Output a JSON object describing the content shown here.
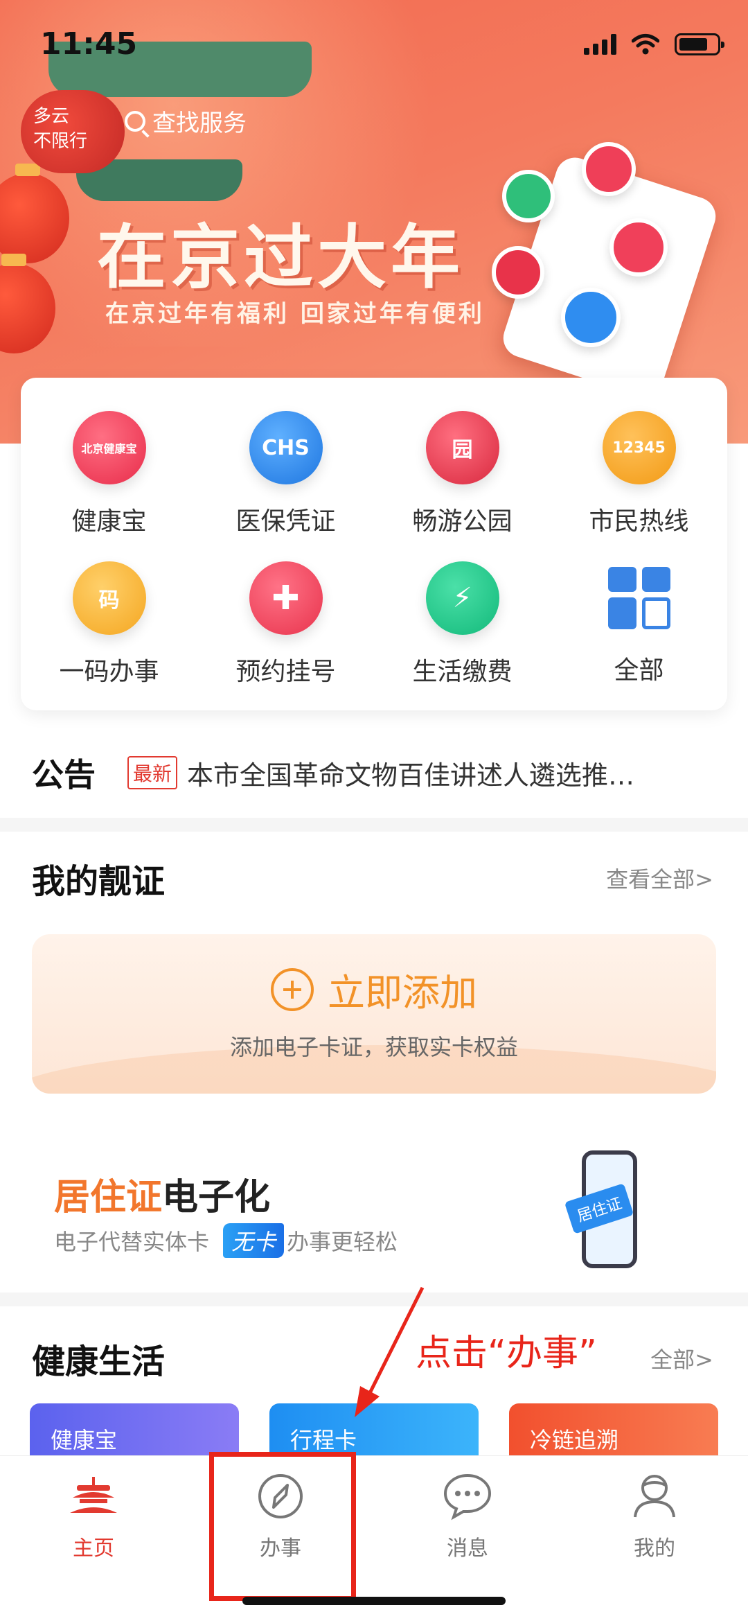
{
  "status_bar": {
    "time": "11:45"
  },
  "header": {
    "weather_line1": "多云",
    "weather_line2": "不限行",
    "search_placeholder": "查找服务"
  },
  "banner": {
    "title": "在京过大年",
    "subtitle": "在京过年有福利  回家过年有便利"
  },
  "services": [
    {
      "label": "健康宝",
      "icon": "temple-health-icon",
      "color": "#f0405a",
      "glyph": "北京健康宝"
    },
    {
      "label": "医保凭证",
      "icon": "chs-insurance-icon",
      "color": "#2f8df0",
      "glyph": "CHS"
    },
    {
      "label": "畅游公园",
      "icon": "park-gate-icon",
      "color": "#e8334a",
      "glyph": "园"
    },
    {
      "label": "市民热线",
      "icon": "headset-hotline-icon",
      "color": "#f5a623",
      "glyph": "12345"
    },
    {
      "label": "一码办事",
      "icon": "briefcase-icon",
      "color": "#f7b531",
      "glyph": "码"
    },
    {
      "label": "预约挂号",
      "icon": "medical-cross-icon",
      "color": "#f0445a",
      "glyph": "✚"
    },
    {
      "label": "生活缴费",
      "icon": "lightning-drop-icon",
      "color": "#1fc98a",
      "glyph": "⚡"
    },
    {
      "label": "全部",
      "icon": "all-grid-icon",
      "color": "#3a84e4",
      "glyph": ""
    }
  ],
  "notice": {
    "logo": "公告",
    "badge": "最新",
    "text": "本市全国革命文物百佳讲述人遴选推…"
  },
  "certificates": {
    "title": "我的靓证",
    "more": "查看全部>",
    "add_label": "立即添加",
    "add_sub": "添加电子卡证，获取实卡权益"
  },
  "promo": {
    "title_highlight": "居住证",
    "title_rest": "电子化",
    "sub_before": "电子代替实体卡",
    "sub_badge": "无卡",
    "sub_after": "办事更轻松",
    "art_badge": "居住证"
  },
  "healthy_life": {
    "title": "健康生活",
    "more": "全部>",
    "cards": [
      {
        "label": "健康宝",
        "color": "#6a6cf0"
      },
      {
        "label": "行程卡",
        "color": "#2a9cf5"
      },
      {
        "label": "冷链追溯",
        "color": "#f2653e"
      }
    ]
  },
  "annotation": {
    "text": "点击“办事”"
  },
  "tabbar": {
    "tabs": [
      {
        "label": "主页",
        "active": true
      },
      {
        "label": "办事",
        "active": false
      },
      {
        "label": "消息",
        "active": false
      },
      {
        "label": "我的",
        "active": false
      }
    ]
  },
  "colors": {
    "accent": "#e23a30",
    "orange": "#f29228",
    "annotation": "#e8251a"
  }
}
